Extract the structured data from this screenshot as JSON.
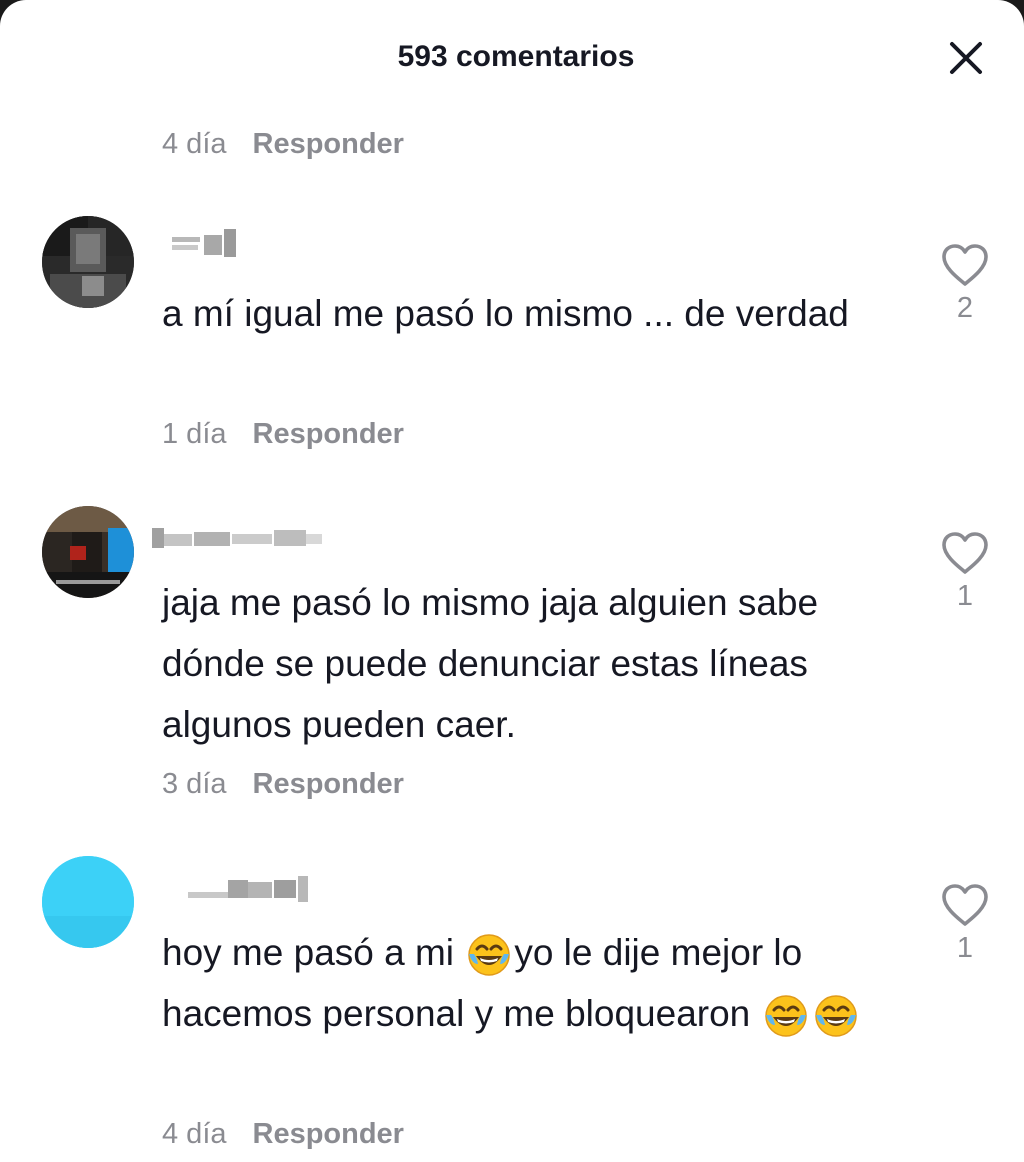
{
  "header": {
    "title": "593 comentarios",
    "close_icon": "close-icon"
  },
  "previous_comment": {
    "time": "4 día",
    "reply_label": "Responder"
  },
  "comments": [
    {
      "username": "",
      "text": "a mí igual me pasó lo mismo ... de verdad",
      "time": "1 día",
      "reply_label": "Responder",
      "likes": "2"
    },
    {
      "username": "",
      "text": "jaja me pasó lo mismo jaja alguien sabe dónde se puede denunciar estas líneas algunos pueden caer.",
      "time": "3 día",
      "reply_label": "Responder",
      "likes": "1"
    },
    {
      "username": "",
      "text_parts": [
        "hoy me pasó a mi ",
        "yo le dije mejor lo hacemos personal y me bloquearon "
      ],
      "emoji": "face-with-tears-of-joy",
      "time": "4 día",
      "reply_label": "Responder",
      "likes": "1"
    }
  ],
  "icons": {
    "like": "heart-outline-icon"
  }
}
